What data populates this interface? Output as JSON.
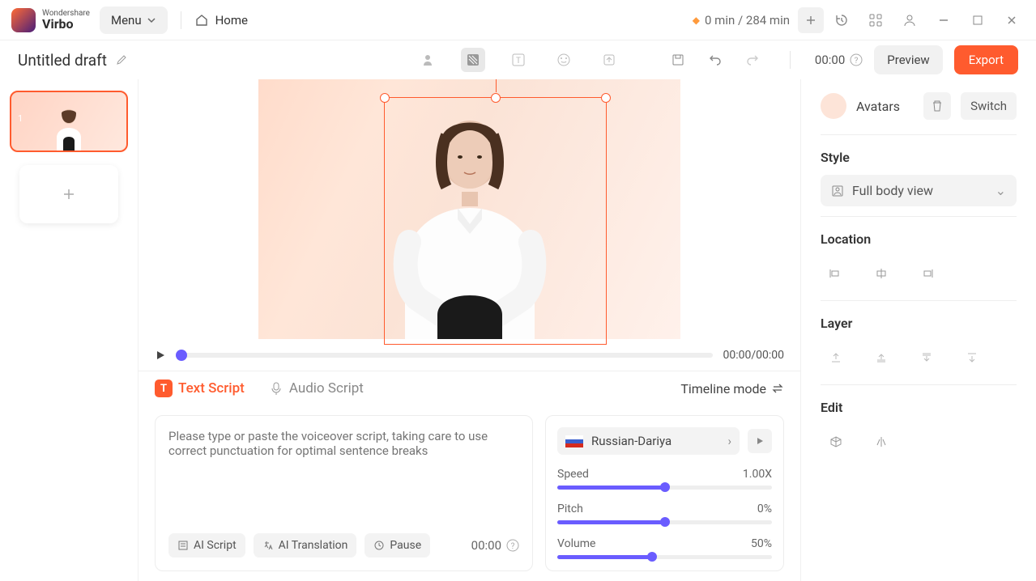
{
  "topbar": {
    "brand_top": "Wondershare",
    "brand": "Virbo",
    "menu": "Menu",
    "home": "Home",
    "credits": "0 min / 284 min"
  },
  "subbar": {
    "title": "Untitled draft",
    "clock": "00:00",
    "preview": "Preview",
    "export": "Export"
  },
  "slides": {
    "first_index": "1"
  },
  "timeline": {
    "time": "00:00/00:00"
  },
  "tabs": {
    "text": "Text Script",
    "audio": "Audio Script",
    "timeline_mode": "Timeline mode"
  },
  "script": {
    "placeholder": "Please type or paste the voiceover script, taking care to use correct punctuation for optimal sentence breaks",
    "ai_script": "AI Script",
    "ai_translation": "AI Translation",
    "pause": "Pause",
    "time": "00:00"
  },
  "voice": {
    "name": "Russian-Dariya",
    "speed_label": "Speed",
    "speed_value": "1.00X",
    "pitch_label": "Pitch",
    "pitch_value": "0%",
    "volume_label": "Volume",
    "volume_value": "50%"
  },
  "right": {
    "avatars": "Avatars",
    "switch": "Switch",
    "style": "Style",
    "style_value": "Full body view",
    "location": "Location",
    "layer": "Layer",
    "edit": "Edit"
  }
}
